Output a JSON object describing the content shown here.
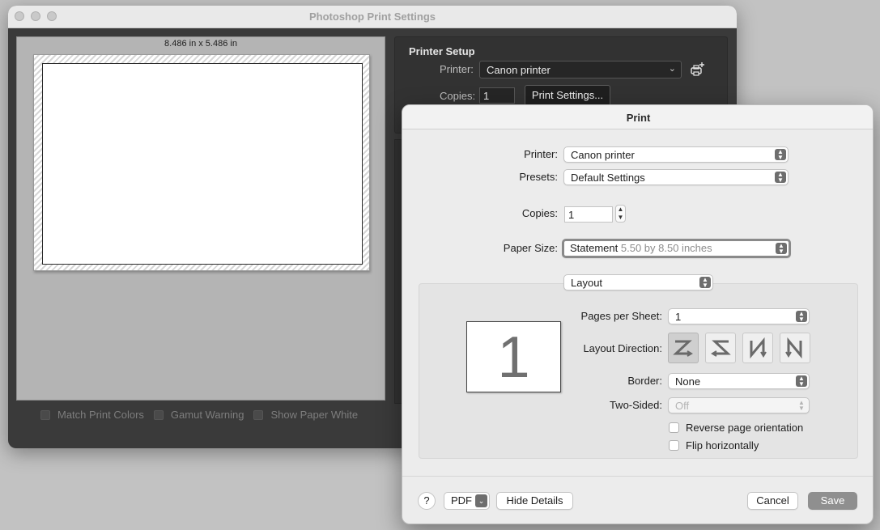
{
  "ps_window": {
    "title": "Photoshop Print Settings",
    "preview_dims": "8.486 in x 5.486 in",
    "printer_setup_title": "Printer Setup",
    "printer_label": "Printer:",
    "printer_value": "Canon printer",
    "copies_label": "Copies:",
    "copies_value": "1",
    "print_settings_button": "Print Settings...",
    "checkboxes": [
      {
        "label": "Match Print Colors",
        "checked": false
      },
      {
        "label": "Gamut Warning",
        "checked": false
      },
      {
        "label": "Show Paper White",
        "checked": false
      }
    ]
  },
  "print_dialog": {
    "title": "Print",
    "printer_label": "Printer:",
    "printer_value": "Canon printer",
    "presets_label": "Presets:",
    "presets_value": "Default Settings",
    "copies_label": "Copies:",
    "copies_value": "1",
    "paper_size_label": "Paper Size:",
    "paper_size_value": "Statement",
    "paper_size_detail": "5.50 by 8.50 inches",
    "section_value": "Layout",
    "layout": {
      "preview_number": "1",
      "pages_per_sheet_label": "Pages per Sheet:",
      "pages_per_sheet_value": "1",
      "layout_direction_label": "Layout Direction:",
      "border_label": "Border:",
      "border_value": "None",
      "two_sided_label": "Two-Sided:",
      "two_sided_value": "Off",
      "reverse_orientation_label": "Reverse page orientation",
      "flip_horizontally_label": "Flip horizontally"
    },
    "footer": {
      "help_label": "?",
      "pdf_label": "PDF",
      "hide_details_label": "Hide Details",
      "cancel_label": "Cancel",
      "save_label": "Save"
    }
  },
  "colors": {
    "desktop": "#c2c2c2",
    "ps_background": "#3a3a3a",
    "dialog_background": "#ececec",
    "primary_button": "#8f8f8f"
  }
}
